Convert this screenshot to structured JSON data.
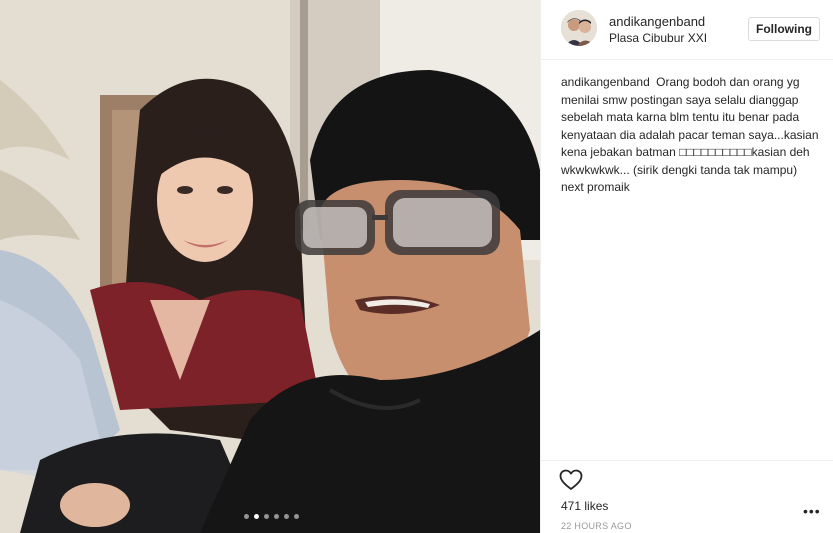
{
  "post": {
    "username": "andikangenband",
    "location": "Plasa Cibubur XXI",
    "follow_label": "Following",
    "caption_user": "andikangenband",
    "caption_text": "Orang bodoh dan orang yg menilai smw postingan saya selalu dianggap sebelah mata karna blm tentu itu benar pada kenyataan dia adalah pacar teman saya...kasian kena jebakan batman □□□□□□□□□□kasian deh wkwkwkwk... (sirik dengki tanda tak mampu) next promaik",
    "likes": "471 likes",
    "timestamp": "22 HOURS AGO",
    "more_label": "•••"
  },
  "carousel": {
    "count": 6,
    "active_index": 1
  },
  "icons": {
    "heart": "heart-icon",
    "more": "more-options-icon"
  }
}
